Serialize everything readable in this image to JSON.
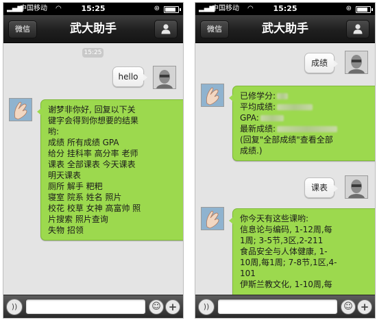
{
  "status": {
    "carrier": "中国移动",
    "time": "15:25"
  },
  "header": {
    "back_label": "微信",
    "title": "武大助手"
  },
  "left": {
    "timestamp": "15:25",
    "sent": "hello",
    "reply_lines": [
      "谢梦非你好, 回复以下关",
      "键字会得到你想要的结果",
      "哟:",
      "成绩 所有成绩 GPA",
      "给分 挂科率 高分率 老师",
      "课表 全部课表 今天课表",
      "明天课表",
      "厕所 解手 粑粑",
      "寝室 院系 姓名 照片",
      "校花 校草 女神 高富帅 照",
      "片搜索 照片查询",
      "失物 招领"
    ]
  },
  "right": {
    "sent_grades": "成绩",
    "grades_reply": {
      "credits_label": "已修学分:",
      "avg_label": "平均成绩:",
      "gpa_label": "GPA:",
      "latest_label": "最新成绩:",
      "hint_line1": "(回复\"全部成绩\"查看全部",
      "hint_line2": "成绩.)"
    },
    "sent_schedule": "课表",
    "schedule_lines": [
      "你今天有这些课哟:",
      "信息论与编码, 1-12周,每",
      "1周; 3-5节,3区,2-211",
      "食品安全与人体健康, 1-",
      "10周,每1周; 7-8节,1区,4-",
      "101",
      "伊斯兰教文化, 1-10周,每"
    ]
  },
  "colors": {
    "bubble_green": "#9cd94e",
    "chat_bg": "#e4e4e4",
    "bar_dark": "#1f1f1f"
  }
}
